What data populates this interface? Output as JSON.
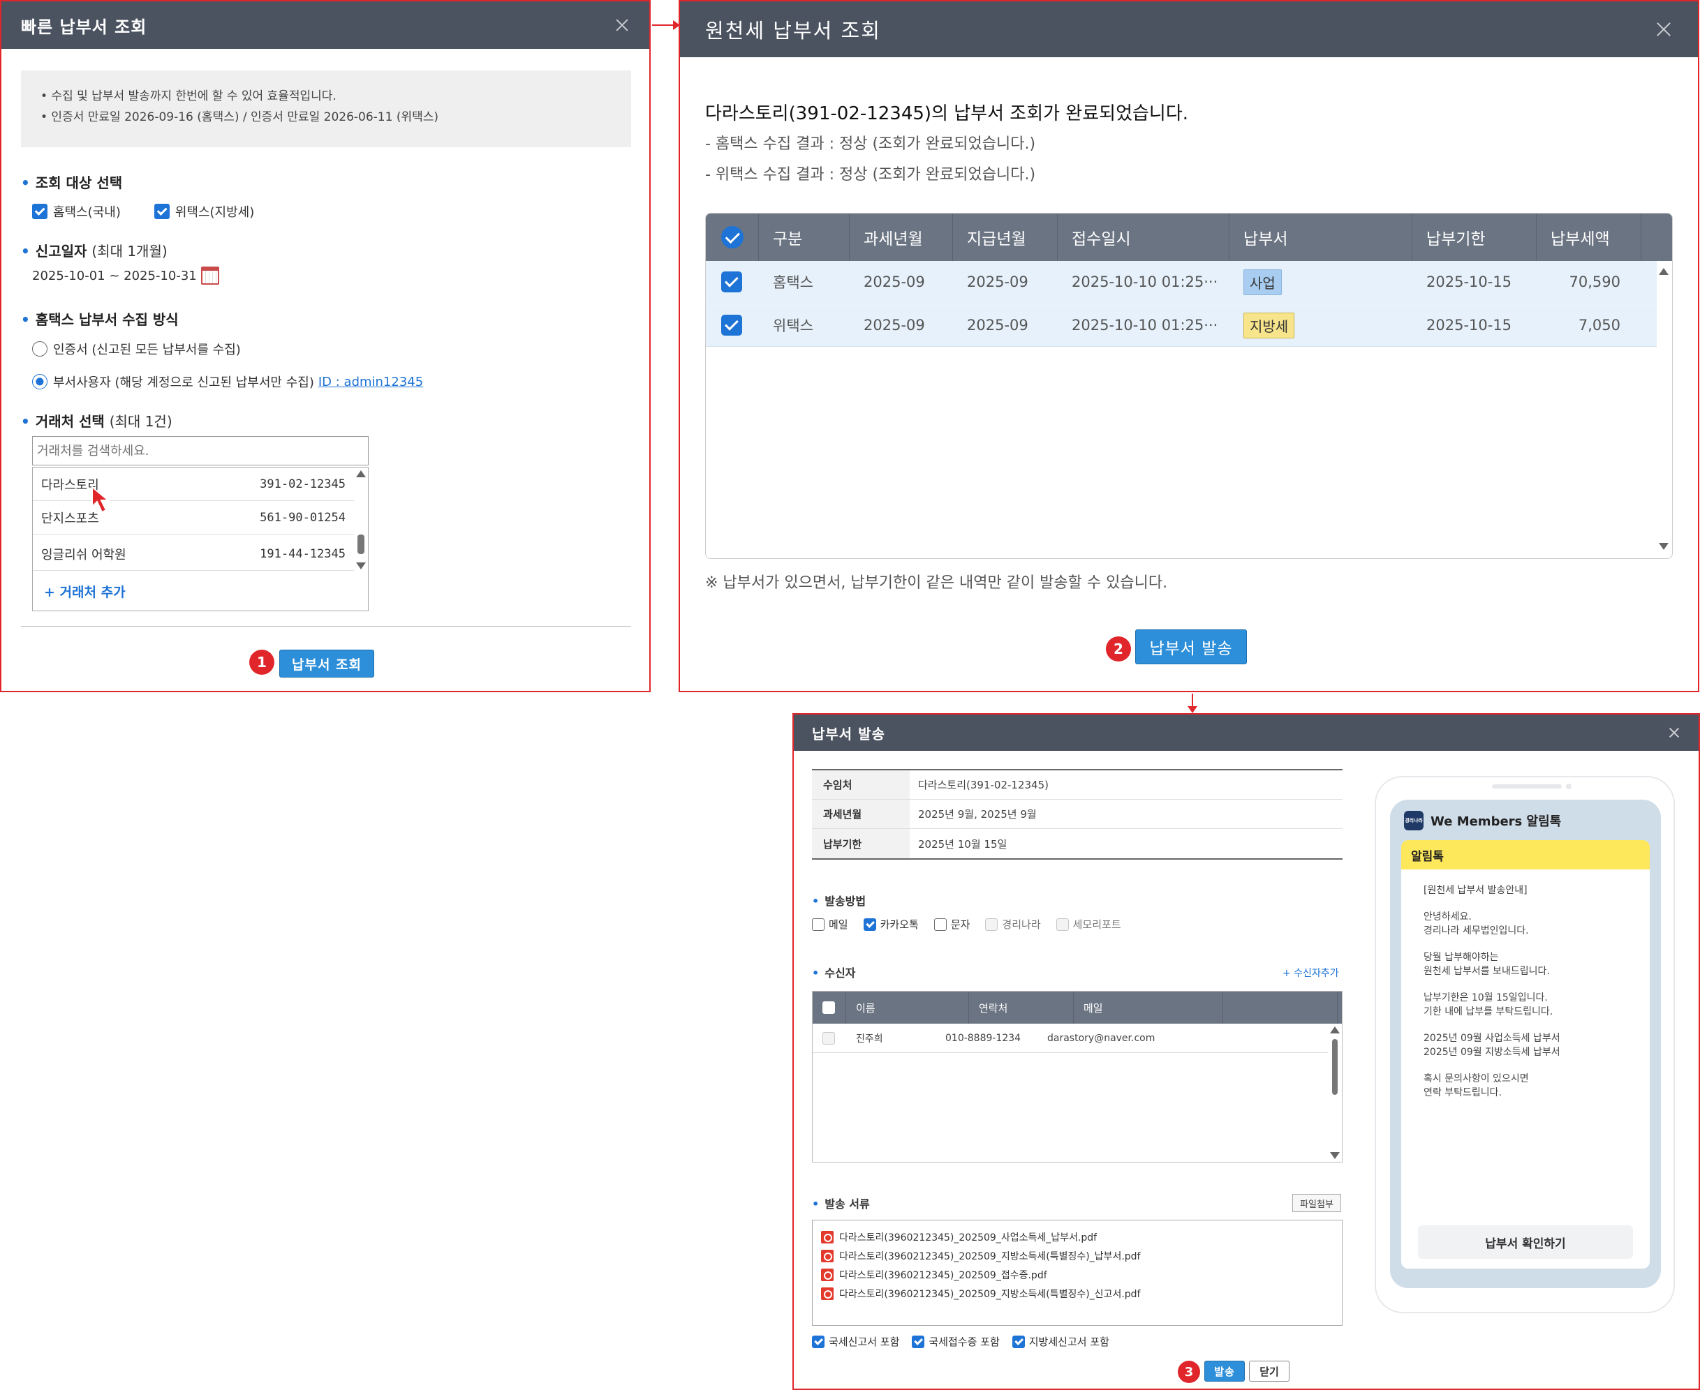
{
  "panel1": {
    "title": "빠른 납부서 조회",
    "notice": [
      "• 수집 및 납부서 발송까지 한번에 할 수 있어 효율적입니다.",
      "• 인증서 만료일 2026-09-16 (홈택스) / 인증서 만료일 2026-06-11 (위택스)"
    ],
    "target": {
      "title": "조회 대상 선택",
      "options": [
        {
          "label": "홈택스(국내)",
          "checked": true
        },
        {
          "label": "위택스(지방세)",
          "checked": true
        }
      ]
    },
    "report_date": {
      "title": "신고일자",
      "sub": "(최대 1개월)",
      "value": "2025-10-01 ~ 2025-10-31"
    },
    "collect_method": {
      "title": "홈택스 납부서 수집 방식",
      "options": [
        {
          "label": "인증서 (신고된 모든 납부서를 수집)",
          "selected": false
        },
        {
          "label": "부서사용자 (해당 계정으로 신고된 납부서만 수집)",
          "selected": true
        }
      ],
      "id_link": "ID : admin12345"
    },
    "vendor": {
      "title": "거래처 선택",
      "sub": "(최대 1건)",
      "search_placeholder": "거래처를 검색하세요.",
      "items": [
        {
          "name": "다라스토리",
          "number": "391-02-12345"
        },
        {
          "name": "단지스포츠",
          "number": "561-90-01254"
        },
        {
          "name": "잉글리쉬 어학원",
          "number": "191-44-12345"
        }
      ],
      "add_label": "+ 거래처 추가"
    },
    "step": "1",
    "button": "납부서 조회"
  },
  "panel2": {
    "title": "원천세 납부서 조회",
    "heading": "다라스토리(391-02-12345)의 납부서 조회가 완료되었습니다.",
    "results": [
      "- 홈택스 수집 결과 : 정상 (조회가 완료되었습니다.)",
      "- 위택스 수집 결과 : 정상 (조회가 완료되었습니다.)"
    ],
    "columns": [
      "구분",
      "과세년월",
      "지급년월",
      "접수일시",
      "납부서",
      "납부기한",
      "납부세액"
    ],
    "rows": [
      {
        "type": "홈택스",
        "tax_month": "2025-09",
        "pay_month": "2025-09",
        "received": "2025-10-10 01:25···",
        "bill": "사업",
        "due": "2025-10-15",
        "amount": "70,590"
      },
      {
        "type": "위택스",
        "tax_month": "2025-09",
        "pay_month": "2025-09",
        "received": "2025-10-10 01:25···",
        "bill": "지방세",
        "due": "2025-10-15",
        "amount": "7,050"
      }
    ],
    "note": "※ 납부서가 있으면서, 납부기한이 같은 내역만 같이 발송할 수 있습니다.",
    "step": "2",
    "button": "납부서 발송"
  },
  "panel3": {
    "title": "납부서 발송",
    "info": [
      {
        "key": "수임처",
        "value": "다라스토리(391-02-12345)"
      },
      {
        "key": "과세년월",
        "value": "2025년 9월, 2025년 9월"
      },
      {
        "key": "납부기한",
        "value": "2025년 10월 15일"
      }
    ],
    "method": {
      "title": "발송방법",
      "options": [
        {
          "label": "메일",
          "state": "off"
        },
        {
          "label": "카카오톡",
          "state": "on"
        },
        {
          "label": "문자",
          "state": "off"
        },
        {
          "label": "경리나라",
          "state": "dis"
        },
        {
          "label": "세모리포트",
          "state": "dis"
        }
      ]
    },
    "recipient": {
      "title": "수신자",
      "add_label": "+ 수신자추가",
      "columns": [
        "이름",
        "연락처",
        "메일"
      ],
      "rows": [
        {
          "name": "진주희",
          "phone": "010-8889-1234",
          "email": "darastory@naver.com"
        }
      ]
    },
    "docs": {
      "title": "발송 서류",
      "attach_label": "파일첨부",
      "files": [
        "다라스토리(3960212345)_202509_사업소득세_납부서.pdf",
        "다라스토리(3960212345)_202509_지방소득세(특별징수)_납부서.pdf",
        "다라스토리(3960212345)_202509_접수증.pdf",
        "다라스토리(3960212345)_202509_지방소득세(특별징수)_신고서.pdf"
      ],
      "includes": [
        "국세신고서 포함",
        "국세접수증 포함",
        "지방세신고서 포함"
      ]
    },
    "step": "3",
    "send_label": "발송",
    "close_label": "닫기",
    "preview": {
      "app_name": "We Members 알림톡",
      "logo_text": "경리나라",
      "card_title": "알림톡",
      "paragraphs": [
        [
          "[원천세 납부서 발송안내]"
        ],
        [
          "안녕하세요.",
          "경리나라 세무법인입니다."
        ],
        [
          "당월 납부해야하는",
          "원천세 납부서를 보내드립니다."
        ],
        [
          "납부기한은 10월 15일입니다.",
          "기한 내에 납부를 부탁드립니다."
        ],
        [
          "2025년 09월 사업소득세 납부서",
          "2025년 09월 지방소득세 납부서"
        ],
        [
          "혹시 문의사항이 있으시면",
          "연락 부탁드립니다."
        ]
      ],
      "button": "납부서 확인하기"
    }
  }
}
